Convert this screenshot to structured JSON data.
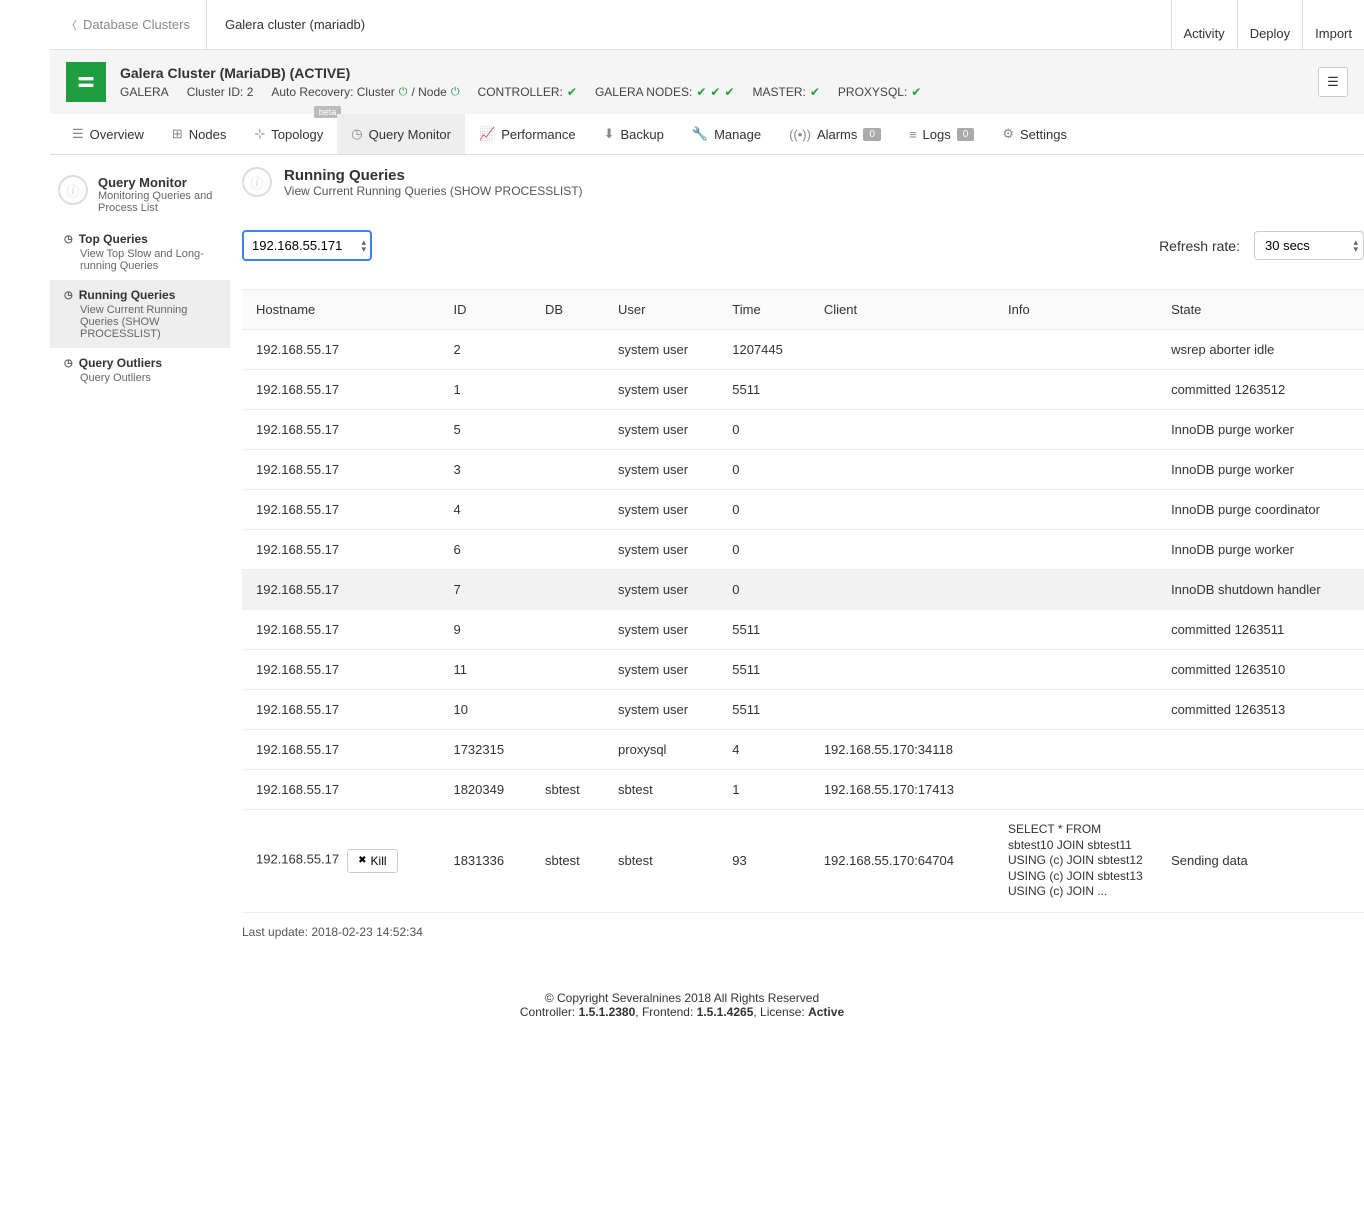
{
  "breadcrumb": {
    "back": "Database Clusters",
    "current": "Galera cluster (mariadb)"
  },
  "topbar_buttons": {
    "activity": "Activity",
    "deploy": "Deploy",
    "import": "Import"
  },
  "cluster": {
    "title": "Galera Cluster (MariaDB) (ACTIVE)",
    "type": "GALERA",
    "cluster_id_label": "Cluster ID: 2",
    "auto_recovery": "Auto Recovery: Cluster",
    "node_label": " / Node",
    "controller": "CONTROLLER:",
    "galera_nodes": "GALERA NODES:",
    "master": "MASTER:",
    "proxysql": "PROXYSQL:"
  },
  "tabs": {
    "overview": "Overview",
    "nodes": "Nodes",
    "topology": "Topology",
    "topology_badge": "beta",
    "query_monitor": "Query Monitor",
    "performance": "Performance",
    "backup": "Backup",
    "manage": "Manage",
    "alarms": "Alarms",
    "alarms_count": "0",
    "logs": "Logs",
    "logs_count": "0",
    "settings": "Settings"
  },
  "sidebar": {
    "title": "Query Monitor",
    "subtitle": "Monitoring Queries and Process List",
    "items": [
      {
        "title": "Top Queries",
        "sub": "View Top Slow and Long-running Queries"
      },
      {
        "title": "Running Queries",
        "sub": "View Current Running Queries (SHOW PROCESSLIST)"
      },
      {
        "title": "Query Outliers",
        "sub": "Query Outliers"
      }
    ]
  },
  "content_header": {
    "title": "Running Queries",
    "sub": "View Current Running Queries (SHOW PROCESSLIST)"
  },
  "controls": {
    "host": "192.168.55.171",
    "refresh_label": "Refresh rate:",
    "refresh_value": "30 secs"
  },
  "table": {
    "headers": [
      "Hostname",
      "ID",
      "DB",
      "User",
      "Time",
      "Client",
      "Info",
      "State"
    ],
    "rows": [
      {
        "host": "192.168.55.17",
        "id": "2",
        "db": "",
        "user": "system user",
        "time": "1207445",
        "client": "",
        "info": "",
        "state": "wsrep aborter idle"
      },
      {
        "host": "192.168.55.17",
        "id": "1",
        "db": "",
        "user": "system user",
        "time": "5511",
        "client": "",
        "info": "",
        "state": "committed 1263512"
      },
      {
        "host": "192.168.55.17",
        "id": "5",
        "db": "",
        "user": "system user",
        "time": "0",
        "client": "",
        "info": "",
        "state": "InnoDB purge worker"
      },
      {
        "host": "192.168.55.17",
        "id": "3",
        "db": "",
        "user": "system user",
        "time": "0",
        "client": "",
        "info": "",
        "state": "InnoDB purge worker"
      },
      {
        "host": "192.168.55.17",
        "id": "4",
        "db": "",
        "user": "system user",
        "time": "0",
        "client": "",
        "info": "",
        "state": "InnoDB purge coordinator"
      },
      {
        "host": "192.168.55.17",
        "id": "6",
        "db": "",
        "user": "system user",
        "time": "0",
        "client": "",
        "info": "",
        "state": "InnoDB purge worker"
      },
      {
        "host": "192.168.55.17",
        "id": "7",
        "db": "",
        "user": "system user",
        "time": "0",
        "client": "",
        "info": "",
        "state": "InnoDB shutdown handler",
        "hl": true
      },
      {
        "host": "192.168.55.17",
        "id": "9",
        "db": "",
        "user": "system user",
        "time": "5511",
        "client": "",
        "info": "",
        "state": "committed 1263511"
      },
      {
        "host": "192.168.55.17",
        "id": "11",
        "db": "",
        "user": "system user",
        "time": "5511",
        "client": "",
        "info": "",
        "state": "committed 1263510"
      },
      {
        "host": "192.168.55.17",
        "id": "10",
        "db": "",
        "user": "system user",
        "time": "5511",
        "client": "",
        "info": "",
        "state": "committed 1263513"
      },
      {
        "host": "192.168.55.17",
        "id": "1732315",
        "db": "",
        "user": "proxysql",
        "time": "4",
        "client": "192.168.55.170:34118",
        "info": "",
        "state": ""
      },
      {
        "host": "192.168.55.17",
        "id": "1820349",
        "db": "sbtest",
        "user": "sbtest",
        "time": "1",
        "client": "192.168.55.170:17413",
        "info": "",
        "state": ""
      },
      {
        "host": "192.168.55.17",
        "id": "1831336",
        "db": "sbtest",
        "user": "sbtest",
        "time": "93",
        "client": "192.168.55.170:64704",
        "info": "SELECT * FROM sbtest10 JOIN sbtest11 USING (c) JOIN sbtest12 USING (c) JOIN sbtest13 USING (c) JOIN ...",
        "state": "Sending data",
        "kill": true
      }
    ]
  },
  "kill_label": "Kill",
  "last_update": "Last update: 2018-02-23 14:52:34",
  "footer": {
    "copyright": "© Copyright Severalnines 2018 All Rights Reserved",
    "controller_label": "Controller:",
    "controller_ver": "1.5.1.2380",
    "frontend_label": ", Frontend:",
    "frontend_ver": "1.5.1.4265",
    "license_label": ", License:",
    "license_val": "Active"
  }
}
